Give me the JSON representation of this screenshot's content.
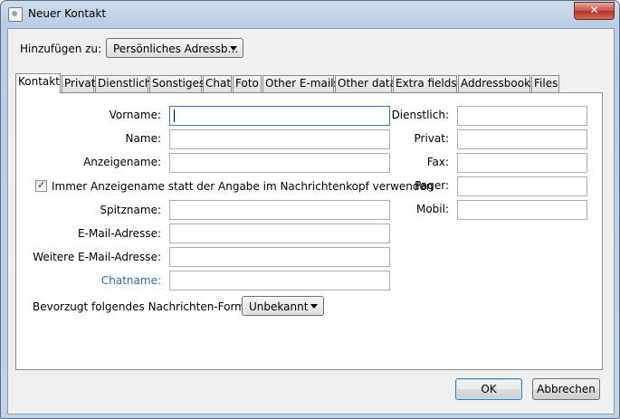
{
  "window": {
    "title": "Neuer Kontakt",
    "close_glyph": "✕"
  },
  "addto": {
    "label": "Hinzufügen zu:",
    "value": "Persönliches Adressb…"
  },
  "tabs": [
    {
      "label": "Kontakt"
    },
    {
      "label": "Privat"
    },
    {
      "label": "Dienstlich"
    },
    {
      "label": "Sonstiges"
    },
    {
      "label": "Chat"
    },
    {
      "label": "Foto"
    },
    {
      "label": "Other E-mails"
    },
    {
      "label": "Other data"
    },
    {
      "label": "Extra fields"
    },
    {
      "label": "Addressbooks"
    },
    {
      "label": "Files"
    }
  ],
  "form": {
    "firstname": {
      "label": "Vorname:",
      "value": ""
    },
    "lastname": {
      "label": "Name:",
      "value": ""
    },
    "displayname": {
      "label": "Anzeigename:",
      "value": ""
    },
    "prefer_display": {
      "label": "Immer Anzeigename statt der Angabe im Nachrichtenkopf verwenden",
      "checked": true,
      "mark": "✓"
    },
    "nickname": {
      "label": "Spitzname:",
      "value": ""
    },
    "email": {
      "label": "E-Mail-Adresse:",
      "value": ""
    },
    "email2": {
      "label": "Weitere E-Mail-Adresse:",
      "value": ""
    },
    "chatname": {
      "label": "Chatname:",
      "value": ""
    },
    "format": {
      "label": "Bevorzugt folgendes Nachrichten-Format:",
      "value": "Unbekannt"
    },
    "work": {
      "label": "Dienstlich:",
      "value": ""
    },
    "home": {
      "label": "Privat:",
      "value": ""
    },
    "fax": {
      "label": "Fax:",
      "value": ""
    },
    "pager": {
      "label": "Pager:",
      "value": ""
    },
    "mobile": {
      "label": "Mobil:",
      "value": ""
    }
  },
  "buttons": {
    "ok": "OK",
    "cancel": "Abbrechen"
  }
}
